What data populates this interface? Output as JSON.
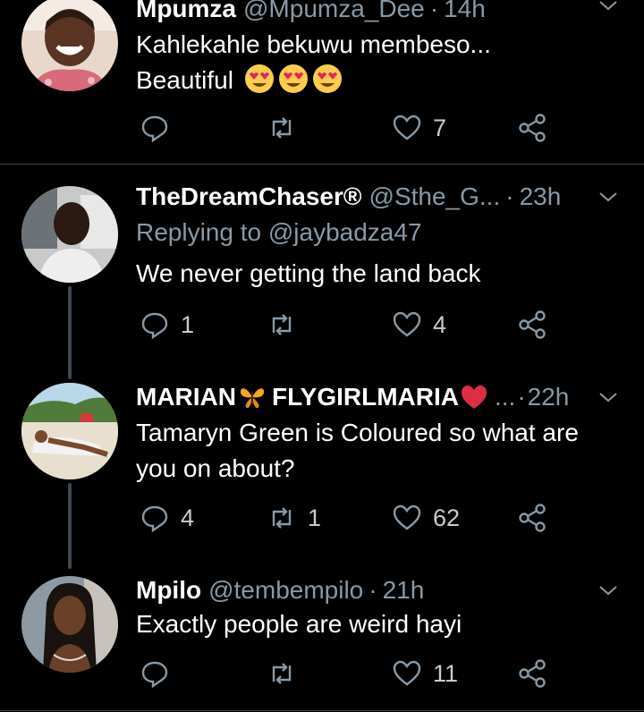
{
  "colors": {
    "background": "#000000",
    "text": "#ffffff",
    "secondary": "#8899a6",
    "divider": "#38444d",
    "heart_red": "#e0245e"
  },
  "tweets": [
    {
      "name": "Mpumza",
      "handle": "@Mpumza_Dee",
      "time": "14h",
      "reply_to": "",
      "text_lines": [
        "Kahlekahle bekuwu membeso...",
        "Beautiful"
      ],
      "emojis": [
        "heart-eyes-emoji",
        "heart-eyes-emoji",
        "heart-eyes-emoji"
      ],
      "replies": "",
      "retweets": "",
      "likes": "7"
    },
    {
      "name": "TheDreamChaser®",
      "handle": "@Sthe_G...",
      "time": "23h",
      "reply_to_prefix": "Replying to",
      "reply_to": "@jaybadza47",
      "text_lines": [
        "We never getting the land back"
      ],
      "replies": "1",
      "retweets": "",
      "likes": "4"
    },
    {
      "name_part1": "MARIAN",
      "name_part2": "FLYGIRLMARIA",
      "handle": "...",
      "time": "22h",
      "text_lines": [
        "Tamaryn Green is Coloured so what are",
        "you on about?"
      ],
      "replies": "4",
      "retweets": "1",
      "likes": "62"
    },
    {
      "name": "Mpilo",
      "handle": "@tembempilo",
      "time": "21h",
      "text_lines": [
        "Exactly people are weird hayi"
      ],
      "replies": "",
      "retweets": "",
      "likes": "11"
    }
  ],
  "separator_dot": "·"
}
